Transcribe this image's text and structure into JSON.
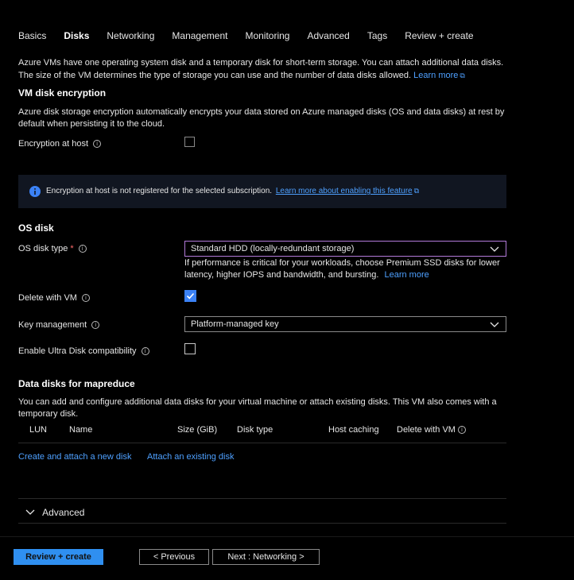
{
  "tabs": [
    "Basics",
    "Disks",
    "Networking",
    "Management",
    "Monitoring",
    "Advanced",
    "Tags",
    "Review + create"
  ],
  "intro": {
    "line1": "Azure VMs have one operating system disk and a temporary disk for short-term storage. You can attach additional data disks.",
    "line2": "The size of the VM determines the type of storage you can use and the number of data disks allowed.",
    "learn_more": "Learn more"
  },
  "encryption": {
    "heading": "VM disk encryption",
    "desc1": "Azure disk storage encryption automatically encrypts your data stored on Azure managed disks (OS and data disks) at rest by",
    "desc2": "default when persisting it to the cloud.",
    "host_label": "Encryption at host",
    "host_checked": false
  },
  "banner": {
    "text": "Encryption at host is not registered for the selected subscription.",
    "link": "Learn more about enabling this feature"
  },
  "os_disk": {
    "heading": "OS disk",
    "type_label": "OS disk type",
    "required_mark": "*",
    "type_value": "Standard HDD (locally-redundant storage)",
    "hint1": "If performance is critical for your workloads, choose Premium SSD disks for lower",
    "hint2": "latency, higher IOPS and bandwidth, and bursting.",
    "hint_link": "Learn more",
    "delete_label": "Delete with VM",
    "delete_checked": true,
    "key_label": "Key management",
    "key_value": "Platform-managed key",
    "ultra_label": "Enable Ultra Disk compatibility",
    "ultra_checked": false
  },
  "data_disks": {
    "heading": "Data disks for mapreduce",
    "desc1": "You can add and configure additional data disks for your virtual machine or attach existing disks. This VM also comes with a",
    "desc2": "temporary disk.",
    "columns": [
      "LUN",
      "Name",
      "Size (GiB)",
      "Disk type",
      "Host caching",
      "Delete with VM"
    ],
    "create_link": "Create and attach a new disk",
    "attach_link": "Attach an existing disk"
  },
  "advanced": {
    "label": "Advanced"
  },
  "footer": {
    "review": "Review + create",
    "previous": "< Previous",
    "next": "Next : Networking >"
  },
  "colors": {
    "accent": "#3b82f6",
    "link": "#4ea0ff",
    "focus": "#b37ad9",
    "banner_bg": "#111621"
  }
}
